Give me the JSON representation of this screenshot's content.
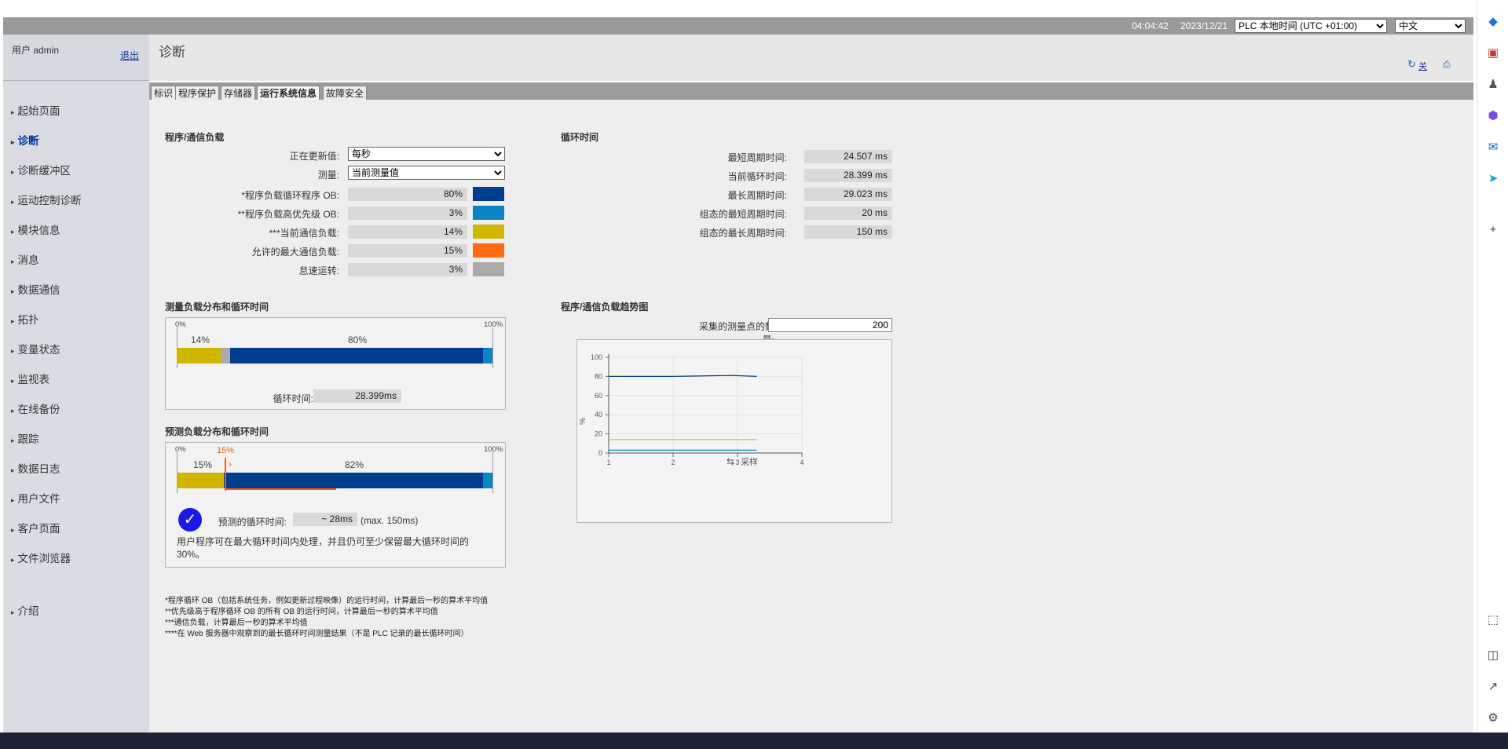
{
  "header": {
    "time": "04:04:42",
    "date": "2023/12/21",
    "timezone_select": "PLC 本地时间 (UTC +01:00)",
    "language_select": "中文"
  },
  "user": {
    "label": "用户 admin",
    "logout": "退出"
  },
  "page_title": "诊断",
  "toolbar": {
    "off_label": "关"
  },
  "sidebar": {
    "items": [
      {
        "label": "起始页面"
      },
      {
        "label": "诊断"
      },
      {
        "label": "诊断缓冲区"
      },
      {
        "label": "运动控制诊断"
      },
      {
        "label": "模块信息"
      },
      {
        "label": "消息"
      },
      {
        "label": "数据通信"
      },
      {
        "label": "拓扑"
      },
      {
        "label": "变量状态"
      },
      {
        "label": "监视表"
      },
      {
        "label": "在线备份"
      },
      {
        "label": "跟踪"
      },
      {
        "label": "数据日志"
      },
      {
        "label": "用户文件"
      },
      {
        "label": "客户页面"
      },
      {
        "label": "文件浏览器"
      },
      {
        "label": "介绍"
      }
    ]
  },
  "tabs": [
    {
      "label": "标识"
    },
    {
      "label": "程序保护"
    },
    {
      "label": "存储器"
    },
    {
      "label": "运行系统信息"
    },
    {
      "label": "故障安全"
    }
  ],
  "load": {
    "title": "程序/通信负载",
    "update_label": "正在更新值:",
    "update_value": "每秒",
    "measure_label": "测量:",
    "measure_value": "当前测量值",
    "rows": [
      {
        "label": "*程序负载循环程序 OB:",
        "value": "80%",
        "color": "#003d8f"
      },
      {
        "label": "**程序负载高优先级 OB:",
        "value": "3%",
        "color": "#0a85c2"
      },
      {
        "label": "***当前通信负载:",
        "value": "14%",
        "color": "#d1b600"
      },
      {
        "label": "允许的最大通信负载:",
        "value": "15%",
        "color": "#ff6a13"
      },
      {
        "label": "怠速运转:",
        "value": "3%",
        "color": "#aaaaaa"
      }
    ]
  },
  "cycle": {
    "title": "循环时间",
    "rows": [
      {
        "label": "最短周期时间:",
        "value": "24.507 ms"
      },
      {
        "label": "当前循环时间:",
        "value": "28.399 ms"
      },
      {
        "label": "最长周期时间:",
        "value": "29.023 ms"
      },
      {
        "label": "组态的最短周期时间:",
        "value": "20 ms"
      },
      {
        "label": "组态的最长周期时间:",
        "value": "150 ms"
      }
    ]
  },
  "measured": {
    "title": "测量负载分布和循环时间",
    "axis_min": "0%",
    "axis_max": "100%",
    "comm_pct": "14%",
    "prog_pct": "80%",
    "segments": [
      {
        "fraction": 0.14,
        "color": "#d1b600"
      },
      {
        "fraction": 0.03,
        "color": "#aaaaaa"
      },
      {
        "fraction": 0.8,
        "color": "#003d8f"
      },
      {
        "fraction": 0.03,
        "color": "#0a85c2"
      }
    ],
    "cycle_label": "循环时间:",
    "cycle_value": "28.399ms"
  },
  "predicted": {
    "title": "预测负载分布和循环时间",
    "axis_min": "0%",
    "axis_max": "100%",
    "marker_pct": "15%",
    "comm_pct": "15%",
    "prog_pct": "82%",
    "segments": [
      {
        "fraction": 0.15,
        "color": "#d1b600"
      },
      {
        "fraction": 0.82,
        "color": "#003d8f"
      },
      {
        "fraction": 0.03,
        "color": "#0a85c2"
      }
    ],
    "cycle_label": "预测的循环时间:",
    "cycle_value": "~ 28ms",
    "cycle_max": "(max. 150ms)",
    "note": "用户程序可在最大循环时间内处理，并且仍可至少保留最大循环时间的30%。"
  },
  "trend": {
    "title": "程序/通信负载趋势图",
    "points_label": "采集的测量点的数量:",
    "points_value": "200",
    "ylabel": "%",
    "xlabel": "采样"
  },
  "chart_data": {
    "type": "line",
    "xlim": [
      1,
      4
    ],
    "ylim": [
      0,
      100
    ],
    "xticks": [
      1,
      2,
      3,
      4
    ],
    "yticks": [
      0,
      20,
      40,
      60,
      80,
      100
    ],
    "xlabel": "采样",
    "ylabel": "%",
    "grid": true,
    "series": [
      {
        "x": [
          1,
          2,
          2.9,
          3.3
        ],
        "values": [
          80,
          80,
          81,
          80
        ],
        "color": "#003d8f"
      },
      {
        "x": [
          1,
          3.3
        ],
        "values": [
          14,
          14
        ],
        "color": "#d1b600"
      },
      {
        "x": [
          1,
          3.3
        ],
        "values": [
          3,
          3
        ],
        "color": "#0a85c2"
      }
    ]
  },
  "footnotes": [
    "*程序循环 OB（包括系统任务，例如更新过程映像）的运行时间，计算最后一秒的算术平均值",
    "**优先级高于程序循环 OB 的所有 OB 的运行时间，计算最后一秒的算术平均值",
    "***通信负载，计算最后一秒的算术平均值",
    "****在 Web 服务器中观察到的最长循环时间测量结果（不是 PLC 记录的最长循环时间）"
  ]
}
